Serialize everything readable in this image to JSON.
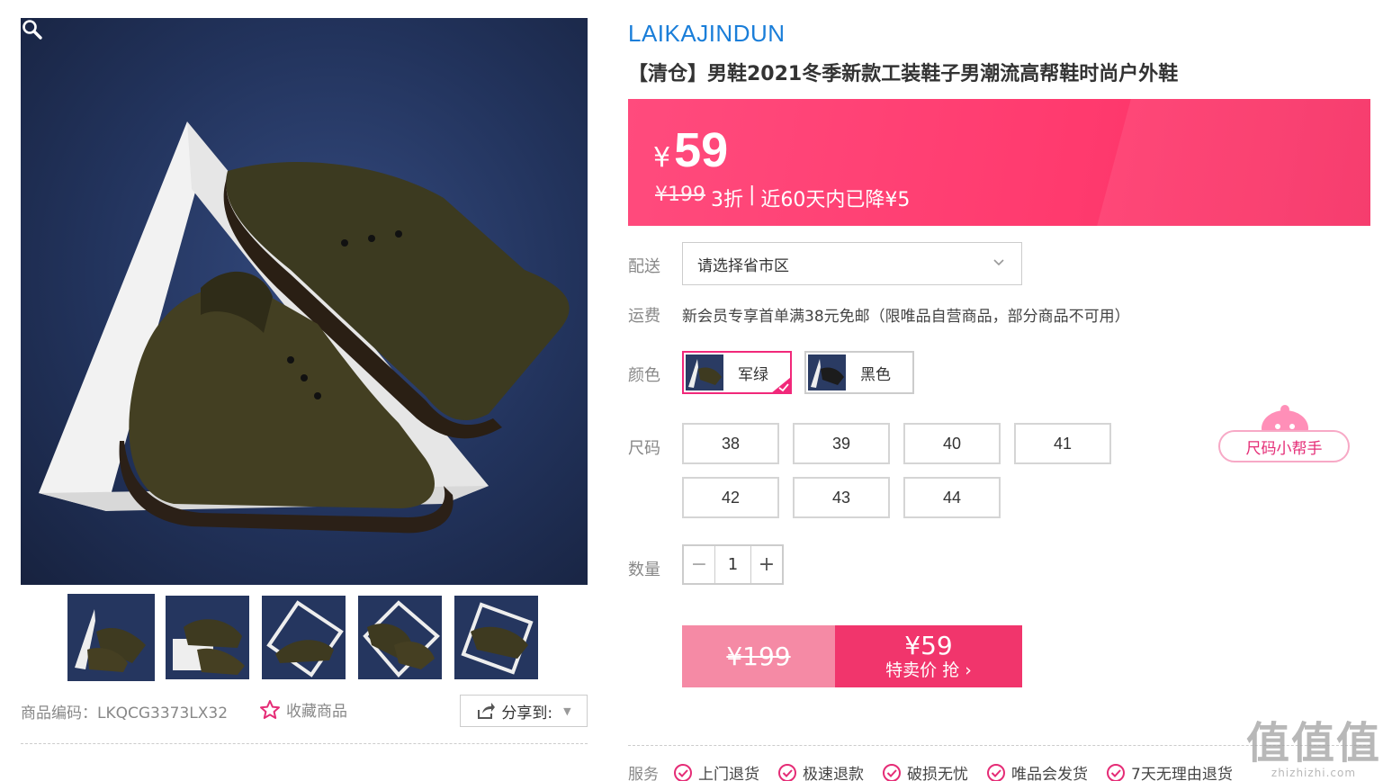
{
  "brand": "LAIKAJINDUN",
  "title": "【清仓】男鞋2021冬季新款工装鞋子男潮流高帮鞋时尚户外鞋",
  "price": {
    "currency": "¥",
    "current": "59",
    "original": "¥199",
    "discount": "3折",
    "separator": "|",
    "drop_note": "近60天内已降¥5"
  },
  "shipping": {
    "label": "配送",
    "select_value": "请选择省市区"
  },
  "freight": {
    "label": "运费",
    "text": "新会员专享首单满38元免邮（限唯品自营商品，部分商品不可用）"
  },
  "color": {
    "label": "颜色",
    "options": [
      {
        "name": "军绿",
        "selected": true
      },
      {
        "name": "黑色",
        "selected": false
      }
    ]
  },
  "size": {
    "label": "尺码",
    "options": [
      "38",
      "39",
      "40",
      "41",
      "42",
      "43",
      "44"
    ],
    "helper": "尺码小帮手"
  },
  "quantity": {
    "label": "数量",
    "value": "1",
    "minus": "−",
    "plus": "+"
  },
  "buy": {
    "original": "¥199",
    "price": "¥59",
    "cta": "特卖价 抢 ›"
  },
  "product_meta": {
    "sku": "商品编码：LKQCG3373LX32",
    "favorite": "收藏商品",
    "share": "分享到:"
  },
  "services": {
    "label": "服务",
    "items": [
      "上门退货",
      "极速退款",
      "破损无忧",
      "唯品会发货",
      "7天无理由退货"
    ]
  },
  "watermark": {
    "big": "值值值",
    "small": "zhizhizhi.com"
  },
  "colors": {
    "accent": "#f1356c",
    "brand_blue": "#1a7ed9",
    "pink_border": "#f1287a"
  },
  "icons": [
    "zoom-icon",
    "star-icon",
    "share-icon",
    "chevron-down-icon",
    "check-circle-icon",
    "checkmark-corner-icon"
  ]
}
